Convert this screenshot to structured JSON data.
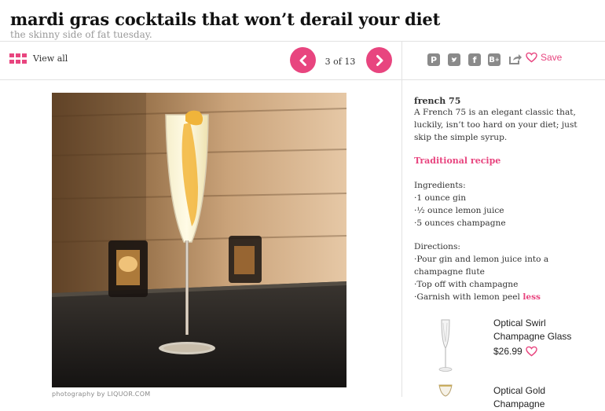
{
  "header": {
    "title": "mardi gras cocktails that won’t derail your diet",
    "subtitle": "the skinny side of fat tuesday."
  },
  "toolbar": {
    "view_all_label": "View all",
    "counter": "3 of 13",
    "save_label": "Save",
    "share_icons": [
      "pinterest-icon",
      "twitter-icon",
      "facebook-icon",
      "blogger-icon",
      "share-icon"
    ]
  },
  "slide": {
    "caption": "photography by LIQUOR.COM",
    "drink_name": "french 75",
    "description": "A French 75 is an elegant classic that, luckily, isn’t too hard on your diet; just skip the simple syrup.",
    "recipe_link": "Traditional recipe",
    "ingredients_heading": "Ingredients:",
    "ingredients": [
      "·1 ounce gin",
      "·½ ounce lemon juice",
      "·5 ounces champagne"
    ],
    "directions_heading": "Directions:",
    "directions": [
      "·Pour gin and lemon juice into a champagne flute",
      "·Top off with champagne",
      "·Garnish with lemon peel"
    ],
    "less_link": "less"
  },
  "products": [
    {
      "name": "Optical Swirl Champagne Glass",
      "price": "$26.99"
    },
    {
      "name": "Optical Gold Champagne"
    }
  ],
  "colors": {
    "accent": "#e8457f",
    "icon_gray": "#8a8a8a"
  }
}
